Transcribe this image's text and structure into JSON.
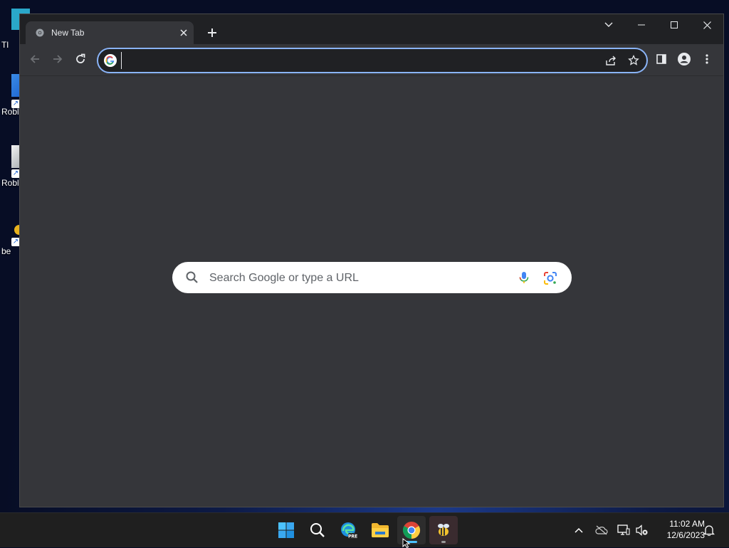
{
  "desktop": {
    "icons": [
      {
        "label": "Tl"
      },
      {
        "label": "Robl"
      },
      {
        "label": "Robl"
      },
      {
        "label": "be"
      }
    ]
  },
  "browser": {
    "tab": {
      "title": "New Tab",
      "close_icon": "close-icon"
    },
    "new_tab_icon": "plus-icon",
    "window_controls": [
      "chevron-down-icon",
      "minimize-icon",
      "maximize-icon",
      "close-icon"
    ],
    "omnibox": {
      "value": "",
      "placeholder": ""
    },
    "search": {
      "placeholder": "Search Google or type a URL"
    }
  },
  "taskbar": {
    "apps": [
      "start",
      "search",
      "edge-pre",
      "file-explorer",
      "chrome",
      "app"
    ],
    "clock": {
      "time": "11:02 AM",
      "date": "12/6/2023"
    }
  },
  "colors": {
    "accent": "#8ab4f8",
    "window_bg": "#35363a",
    "tabstrip_bg": "#202124",
    "taskbar_bg": "#1f1f1f"
  }
}
